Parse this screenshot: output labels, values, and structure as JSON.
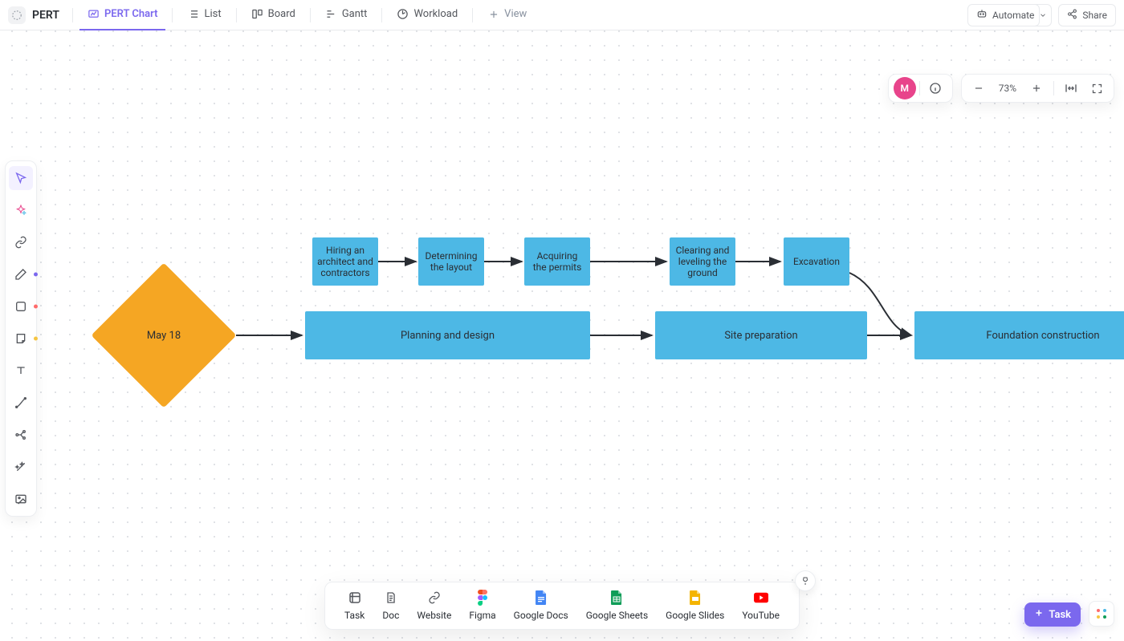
{
  "page": {
    "title": "PERT"
  },
  "views": {
    "tabs": [
      {
        "key": "pert",
        "label": "PERT Chart",
        "active": true
      },
      {
        "key": "list",
        "label": "List"
      },
      {
        "key": "board",
        "label": "Board"
      },
      {
        "key": "gantt",
        "label": "Gantt"
      },
      {
        "key": "workload",
        "label": "Workload"
      }
    ],
    "add_label": "View"
  },
  "topright": {
    "automate": "Automate",
    "share": "Share"
  },
  "canvas_controls": {
    "avatar_initial": "M",
    "zoom_label": "73%"
  },
  "diagram": {
    "milestone": "May 18",
    "small_nodes": [
      "Hiring an architect and contractors",
      "Determining the layout",
      "Acquiring the permits",
      "Clearing and leveling the ground",
      "Excavation"
    ],
    "phase_nodes": [
      "Planning and design",
      "Site preparation",
      "Foundation construction"
    ]
  },
  "dock": {
    "items": [
      {
        "key": "task",
        "label": "Task"
      },
      {
        "key": "doc",
        "label": "Doc"
      },
      {
        "key": "website",
        "label": "Website"
      },
      {
        "key": "figma",
        "label": "Figma"
      },
      {
        "key": "gdocs",
        "label": "Google Docs"
      },
      {
        "key": "gsheets",
        "label": "Google Sheets"
      },
      {
        "key": "gslides",
        "label": "Google Slides"
      },
      {
        "key": "youtube",
        "label": "YouTube"
      }
    ]
  },
  "footer": {
    "task_button": "Task"
  },
  "colors": {
    "accent": "#7b68ee",
    "node": "#4db8e5",
    "milestone": "#f5a623",
    "avatar": "#e8448b"
  }
}
